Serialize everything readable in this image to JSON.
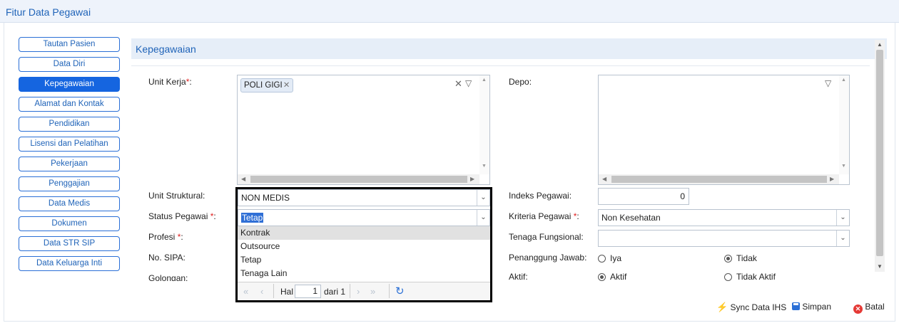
{
  "window": {
    "title": "Fitur Data Pegawai"
  },
  "nav": {
    "items": [
      {
        "label": "Tautan Pasien"
      },
      {
        "label": "Data Diri"
      },
      {
        "label": "Kepegawaian"
      },
      {
        "label": "Alamat dan Kontak"
      },
      {
        "label": "Pendidikan"
      },
      {
        "label": "Lisensi dan Pelatihan"
      },
      {
        "label": "Pekerjaan"
      },
      {
        "label": "Penggajian"
      },
      {
        "label": "Data Medis"
      },
      {
        "label": "Dokumen"
      },
      {
        "label": "Data STR SIP"
      },
      {
        "label": "Data Keluarga Inti"
      }
    ],
    "active": "Kepegawaian"
  },
  "panel": {
    "title": "Kepegawaian"
  },
  "form": {
    "unit_kerja": {
      "label": "Unit Kerja",
      "req": "*",
      "colon": ":",
      "chip": "POLI GIGI"
    },
    "depo": {
      "label": "Depo:"
    },
    "unit_struktural": {
      "label": "Unit Struktural:",
      "value": "NON MEDIS"
    },
    "status_pegawai": {
      "label": "Status Pegawai ",
      "req": "*",
      "colon": ":",
      "value": "Tetap"
    },
    "profesi": {
      "label": "Profesi ",
      "req": "*",
      "colon": ":"
    },
    "no_sipa": {
      "label": "No. SIPA:"
    },
    "golongan": {
      "label": "Golongan:"
    },
    "indeks_pegawai": {
      "label": "Indeks Pegawai:",
      "value": "0"
    },
    "kriteria_pegawai": {
      "label": "Kriteria Pegawai ",
      "req": "*",
      "colon": ":",
      "value": "Non Kesehatan"
    },
    "tenaga_fungsional": {
      "label": "Tenaga Fungsional:",
      "value": ""
    },
    "penanggung_jawab": {
      "label": "Penanggung Jawab:",
      "options": [
        "Iya",
        "Tidak"
      ],
      "selected": "Tidak"
    },
    "aktif": {
      "label": "Aktif:",
      "options": [
        "Aktif",
        "Tidak Aktif"
      ],
      "selected": "Aktif"
    }
  },
  "dropdown": {
    "options": [
      "Kontrak",
      "Outsource",
      "Tetap",
      "Tenaga Lain"
    ],
    "highlighted": "Kontrak",
    "pager": {
      "hal_label": "Hal",
      "page": "1",
      "of_label": "dari 1"
    }
  },
  "footer": {
    "sync_label": "Sync Data IHS",
    "save_label": "Simpan",
    "cancel_label": "Batal"
  },
  "colors": {
    "accent": "#1565e0",
    "title": "#1f63b8",
    "required": "#e02020",
    "cancel": "#e53935",
    "sync": "#f0b400"
  }
}
